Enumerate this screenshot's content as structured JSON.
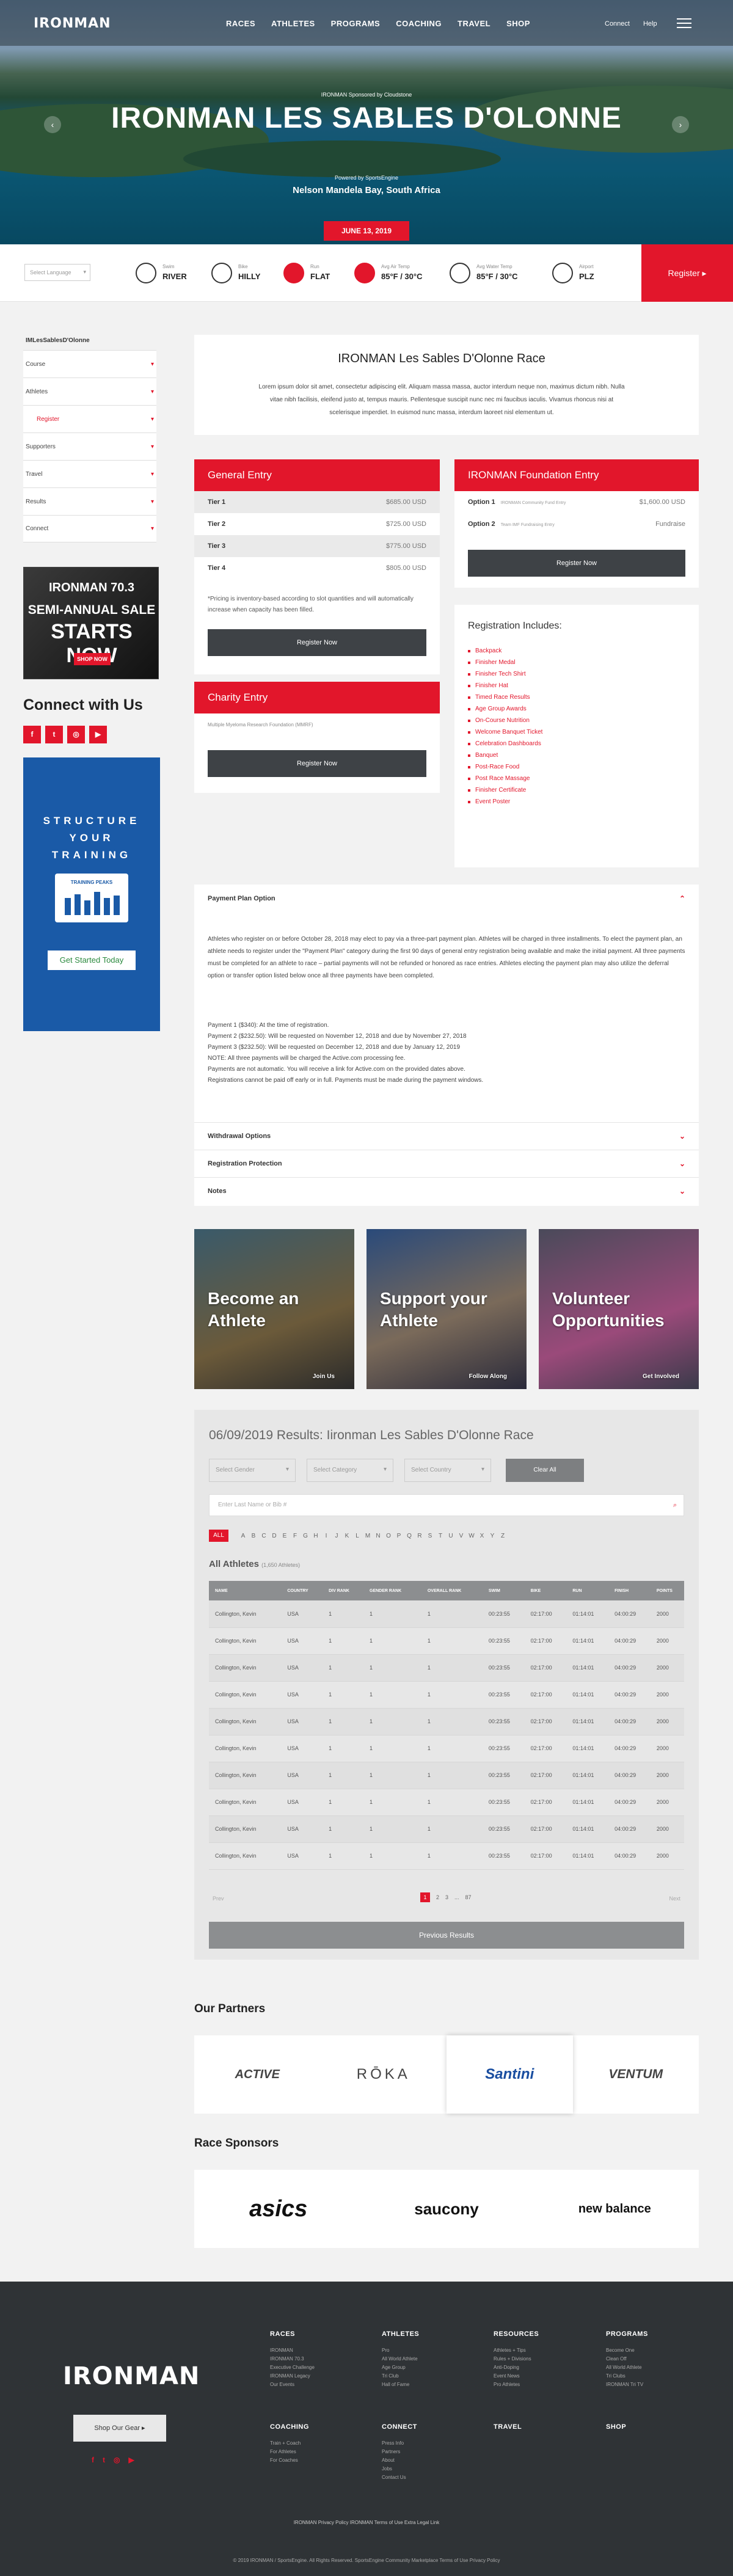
{
  "nav": {
    "logo": "IRONMAN",
    "main": [
      "RACES",
      "ATHLETES",
      "PROGRAMS",
      "COACHING",
      "TRAVEL",
      "SHOP"
    ],
    "util": [
      "Connect",
      "Help"
    ]
  },
  "hero": {
    "kicker": "IRONMAN Sponsored by Cloudstone",
    "title": "IRONMAN LES SABLES D'OLONNE",
    "powered": "Powered by SportsEngine",
    "location": "Nelson Mandela Bay, South Africa",
    "date": "JUNE 13, 2019"
  },
  "stats": {
    "language": "Select Language",
    "items": [
      {
        "label": "Swim",
        "value": "RIVER",
        "icon": "swim-icon"
      },
      {
        "label": "Bike",
        "value": "HILLY",
        "icon": "bike-icon"
      },
      {
        "label": "Run",
        "value": "FLAT",
        "icon": "run-icon"
      },
      {
        "label": "Avg Air Temp",
        "value": "85°F / 30°C",
        "icon": "thermometer-icon"
      },
      {
        "label": "Avg Water Temp",
        "value": "85°F / 30°C",
        "icon": "water-temp-icon"
      },
      {
        "label": "Airport",
        "value": "PLZ",
        "icon": "airport-icon"
      }
    ],
    "register": "Register ▸"
  },
  "sidebar": {
    "breadcrumb": "IMLesSablesD'Olonne",
    "items": [
      "Course",
      "Athletes",
      "Register",
      "Supporters",
      "Travel",
      "Results",
      "Connect"
    ],
    "connect_title": "Connect with Us",
    "social": [
      "f",
      "t",
      "◎",
      "▶"
    ],
    "ad_sale": {
      "top": "IRONMAN 70.3",
      "line1": "SEMI-ANNUAL SALE",
      "line2": "STARTS NOW",
      "cta": "SHOP NOW"
    },
    "ad_train": {
      "headline": "STRUCTURE YOUR TRAINING",
      "brand": "TRAINING PEAKS",
      "cta": "Get Started Today"
    }
  },
  "intro": {
    "title": "IRONMAN Les Sables D'Olonne Race",
    "text": "Lorem ipsum dolor sit amet, consectetur adipiscing elit. Aliquam massa massa, auctor interdum neque non, maximus dictum nibh. Nulla vitae nibh facilisis, eleifend justo at, tempus mauris. Pellentesque suscipit nunc nec mi faucibus iaculis. Vivamus rhoncus nisi at scelerisque imperdiet. In euismod nunc massa, interdum laoreet nisl elementum ut."
  },
  "general_entry": {
    "title": "General Entry",
    "tiers": [
      {
        "name": "Tier 1",
        "price": "$685.00 USD"
      },
      {
        "name": "Tier 2",
        "price": "$725.00 USD"
      },
      {
        "name": "Tier 3",
        "price": "$775.00 USD"
      },
      {
        "name": "Tier 4",
        "price": "$805.00 USD"
      }
    ],
    "note": "*Pricing is inventory-based according to slot quantities and will automatically increase when capacity has been filled.",
    "button": "Register Now"
  },
  "foundation_entry": {
    "title": "IRONMAN Foundation Entry",
    "options": [
      {
        "name": "Option 1",
        "desc": "IRONMAN Community Fund Entry",
        "price": "$1,600.00 USD"
      },
      {
        "name": "Option 2",
        "desc": "Team IMF Fundraising Entry",
        "price": "Fundraise"
      }
    ],
    "button": "Register Now"
  },
  "charity_entry": {
    "title": "Charity Entry",
    "org": "Multiple Myeloma Research Foundation (MMRF)",
    "button": "Register Now"
  },
  "includes": {
    "title": "Registration Includes:",
    "items": [
      "Backpack",
      "Finisher Medal",
      "Finisher Tech Shirt",
      "Finisher Hat",
      "Timed Race Results",
      "Age Group Awards",
      "On-Course Nutrition",
      "Welcome Banquet Ticket",
      "Celebration Dashboards",
      "Banquet",
      "Post-Race Food",
      "Post Race Massage",
      "Finisher Certificate",
      "Event Poster"
    ]
  },
  "payment": {
    "title": "Payment Plan Option",
    "para": "Athletes who register on or before October 28, 2018 may elect to pay via a three-part payment plan. Athletes will be charged in three installments. To elect the payment plan, an athlete needs to register under the \"Payment Plan\" category during the first 90 days of general entry registration being available and make the initial payment. All three payments must be completed for an athlete to race – partial payments will not be refunded or honored as race entries. Athletes electing the payment plan may also utilize the deferral option or transfer option listed below once all three payments have been completed.",
    "lines": [
      "Payment 1 ($340): At the time of registration.",
      "Payment 2 ($232.50): Will be requested on November 12, 2018 and due by November 27, 2018",
      "Payment 3 ($232.50): Will be requested on December 12, 2018 and due by January 12, 2019",
      "NOTE: All three payments will be charged the Active.com processing fee.",
      "Payments are not automatic. You will receive a link for Active.com on the provided dates above.",
      "Registrations cannot be paid off early or in full. Payments must be made during the payment windows."
    ],
    "accordions": [
      "Withdrawal Options",
      "Registration Protection",
      "Notes"
    ]
  },
  "tiles": [
    {
      "title": "Become an Athlete",
      "link": "Join Us"
    },
    {
      "title": "Support your Athlete",
      "link": "Follow Along"
    },
    {
      "title": "Volunteer Opportunities",
      "link": "Get Involved"
    }
  ],
  "results": {
    "title": "06/09/2019 Results: Iironman Les Sables D'Olonne Race",
    "filters": [
      "Select Gender",
      "Select Category",
      "Select Country"
    ],
    "clear": "Clear All",
    "search_placeholder": "Enter Last Name or Bib #",
    "alphabet": [
      "ALL",
      "A",
      "B",
      "C",
      "D",
      "E",
      "F",
      "G",
      "H",
      "I",
      "J",
      "K",
      "L",
      "M",
      "N",
      "O",
      "P",
      "Q",
      "R",
      "S",
      "T",
      "U",
      "V",
      "W",
      "X",
      "Y",
      "Z"
    ],
    "subtitle": "All Athletes",
    "count": "(1,650 Athletes)",
    "columns": [
      "NAME",
      "COUNTRY",
      "DIV RANK",
      "GENDER RANK",
      "OVERALL RANK",
      "SWIM",
      "BIKE",
      "RUN",
      "FINISH",
      "POINTS"
    ],
    "rows": [
      [
        "Collington, Kevin",
        "USA",
        "1",
        "1",
        "1",
        "00:23:55",
        "02:17:00",
        "01:14:01",
        "04:00:29",
        "2000"
      ],
      [
        "Collington, Kevin",
        "USA",
        "1",
        "1",
        "1",
        "00:23:55",
        "02:17:00",
        "01:14:01",
        "04:00:29",
        "2000"
      ],
      [
        "Collington, Kevin",
        "USA",
        "1",
        "1",
        "1",
        "00:23:55",
        "02:17:00",
        "01:14:01",
        "04:00:29",
        "2000"
      ],
      [
        "Collington, Kevin",
        "USA",
        "1",
        "1",
        "1",
        "00:23:55",
        "02:17:00",
        "01:14:01",
        "04:00:29",
        "2000"
      ],
      [
        "Collington, Kevin",
        "USA",
        "1",
        "1",
        "1",
        "00:23:55",
        "02:17:00",
        "01:14:01",
        "04:00:29",
        "2000"
      ],
      [
        "Collington, Kevin",
        "USA",
        "1",
        "1",
        "1",
        "00:23:55",
        "02:17:00",
        "01:14:01",
        "04:00:29",
        "2000"
      ],
      [
        "Collington, Kevin",
        "USA",
        "1",
        "1",
        "1",
        "00:23:55",
        "02:17:00",
        "01:14:01",
        "04:00:29",
        "2000"
      ],
      [
        "Collington, Kevin",
        "USA",
        "1",
        "1",
        "1",
        "00:23:55",
        "02:17:00",
        "01:14:01",
        "04:00:29",
        "2000"
      ],
      [
        "Collington, Kevin",
        "USA",
        "1",
        "1",
        "1",
        "00:23:55",
        "02:17:00",
        "01:14:01",
        "04:00:29",
        "2000"
      ],
      [
        "Collington, Kevin",
        "USA",
        "1",
        "1",
        "1",
        "00:23:55",
        "02:17:00",
        "01:14:01",
        "04:00:29",
        "2000"
      ]
    ],
    "pager": {
      "prev": "Prev",
      "pages": [
        "1",
        "2",
        "3",
        "...",
        "87"
      ],
      "next": "Next"
    },
    "previous_results": "Previous Results"
  },
  "partners": {
    "title": "Our Partners",
    "items": [
      "ACTIVE",
      "RŌKA",
      "Santini",
      "VENTUM"
    ]
  },
  "sponsors": {
    "title": "Race Sponsors",
    "items": [
      "asics",
      "saucony",
      "new balance"
    ]
  },
  "footer": {
    "logo": "IRONMAN",
    "shop": "Shop Our Gear ▸",
    "columns": [
      {
        "title": "RACES",
        "links": [
          "IRONMAN",
          "IRONMAN 70.3",
          "Executive Challenge",
          "IRONMAN Legacy",
          "Our Events"
        ]
      },
      {
        "title": "ATHLETES",
        "links": [
          "Pro",
          "All World Athlete",
          "Age Group",
          "Tri Club",
          "Hall of Fame"
        ]
      },
      {
        "title": "RESOURCES",
        "links": [
          "Athletes + Tips",
          "Rules + Divisions",
          "Anti-Doping",
          "Event News",
          "Pro Athletes"
        ]
      },
      {
        "title": "PROGRAMS",
        "links": [
          "Become One",
          "Clean Off",
          "All World Athlete",
          "Tri Clubs",
          "IRONMAN Tri TV"
        ]
      },
      {
        "title": "COACHING",
        "links": [
          "Train + Coach",
          "For Athletes",
          "For Coaches"
        ]
      },
      {
        "title": "CONNECT",
        "links": [
          "Press Info",
          "Partners",
          "About",
          "Jobs",
          "Contact Us"
        ]
      },
      {
        "title": "TRAVEL",
        "links": []
      },
      {
        "title": "SHOP",
        "links": []
      }
    ],
    "links": "IRONMAN Privacy Policy   IRONMAN Terms of Use   Extra Legal Link",
    "copyright": "© 2019 IRONMAN / SportsEngine. All Rights Reserved.   SportsEngine Community   Marketplace   Terms of Use   Privacy Policy"
  },
  "colors": {
    "accent": "#e2162b",
    "dark": "#2f3336",
    "button": "#3e4246"
  }
}
